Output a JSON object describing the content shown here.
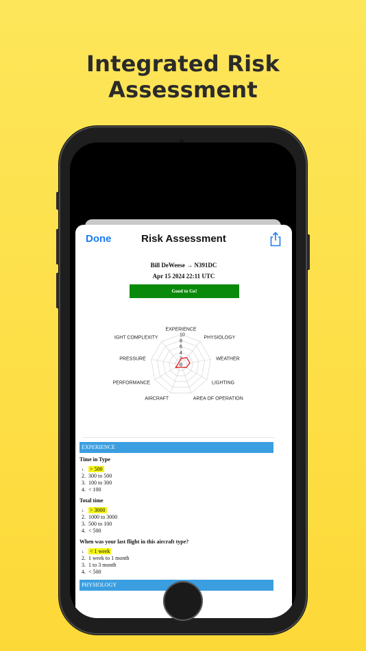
{
  "headline": {
    "line1": "Integrated Risk",
    "line2": "Assessment"
  },
  "nav": {
    "done": "Done",
    "title": "Risk Assessment",
    "share_icon": "share-icon"
  },
  "report": {
    "pilot_line": "Bill DeWeese → N391DC",
    "date_line": "Apr 15 2024 22:11 UTC",
    "status": "Good to Go!",
    "status_color": "#0a8a0a"
  },
  "radar": {
    "axis_labels": [
      "EXPERIENCE",
      "PHYSIOLOGY",
      "WEATHER",
      "LIGHTING",
      "AREA OF OPERATION",
      "AIRCRAFT",
      "PERFORMANCE",
      "PRESSURE",
      "IGHT COMPLEXITY"
    ],
    "ticks": [
      "10",
      "8",
      "6",
      "4",
      "2",
      "0"
    ],
    "values": [
      2,
      3,
      3,
      2,
      1,
      1,
      2,
      1,
      1
    ],
    "max": 10,
    "line_color": "#e02020"
  },
  "sections": {
    "experience": "EXPERIENCE",
    "physiology": "PHYSIOLOGY",
    "color": "#3b9ee0"
  },
  "questions": [
    {
      "title": "Time in Type",
      "options": [
        {
          "num": "1.",
          "text": "> 500",
          "selected": true
        },
        {
          "num": "2.",
          "text": "300 to 500",
          "selected": false
        },
        {
          "num": "3.",
          "text": "100 to 300",
          "selected": false
        },
        {
          "num": "4.",
          "text": "< 100",
          "selected": false
        }
      ]
    },
    {
      "title": "Total time",
      "options": [
        {
          "num": "1.",
          "text": "> 3000",
          "selected": true
        },
        {
          "num": "2.",
          "text": "1000 to 3000",
          "selected": false
        },
        {
          "num": "3.",
          "text": "500 to 100",
          "selected": false
        },
        {
          "num": "4.",
          "text": "< 500",
          "selected": false
        }
      ]
    },
    {
      "title": "When was your last flight in this aircraft type?",
      "options": [
        {
          "num": "1.",
          "text": "< 1 week",
          "selected": true
        },
        {
          "num": "2.",
          "text": "1 week to 1 month",
          "selected": false
        },
        {
          "num": "3.",
          "text": "1 to 3 month",
          "selected": false
        },
        {
          "num": "4.",
          "text": "< 500",
          "selected": false
        }
      ]
    }
  ],
  "colors": {
    "background": "#fdd938",
    "accent": "#1a7cf0",
    "highlight": "#f5f516"
  }
}
